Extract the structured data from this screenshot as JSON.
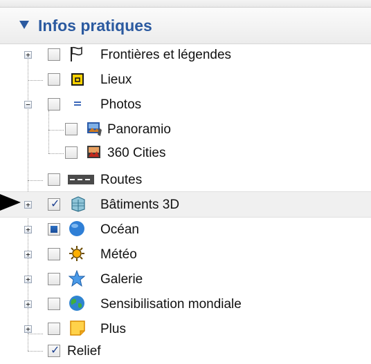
{
  "header": {
    "title": "Infos pratiques"
  },
  "layers": [
    {
      "label": "Frontières et légendes",
      "icon": "flag-icon",
      "checked": false
    },
    {
      "label": "Lieux",
      "icon": "place-square-icon",
      "checked": false
    },
    {
      "label": "Photos",
      "icon": "photos-icon",
      "checked": false
    },
    {
      "label": "Panoramio",
      "icon": "panoramio-icon",
      "checked": false
    },
    {
      "label": "360 Cities",
      "icon": "photo-360-icon",
      "checked": false
    },
    {
      "label": "Routes",
      "icon": "roads-icon",
      "checked": false
    },
    {
      "label": "Bâtiments 3D",
      "icon": "buildings-3d-icon",
      "checked": true
    },
    {
      "label": "Océan",
      "icon": "ocean-globe-icon",
      "checked": "partial"
    },
    {
      "label": "Météo",
      "icon": "sun-icon",
      "checked": false
    },
    {
      "label": "Galerie",
      "icon": "star-icon",
      "checked": false
    },
    {
      "label": "Sensibilisation mondiale",
      "icon": "earth-icon",
      "checked": false
    },
    {
      "label": "Plus",
      "icon": "note-icon",
      "checked": false
    },
    {
      "label": "Relief",
      "icon": "",
      "checked": true
    }
  ],
  "colors": {
    "accent": "#2b5aa0",
    "selected_row": "#f0f0f0"
  }
}
